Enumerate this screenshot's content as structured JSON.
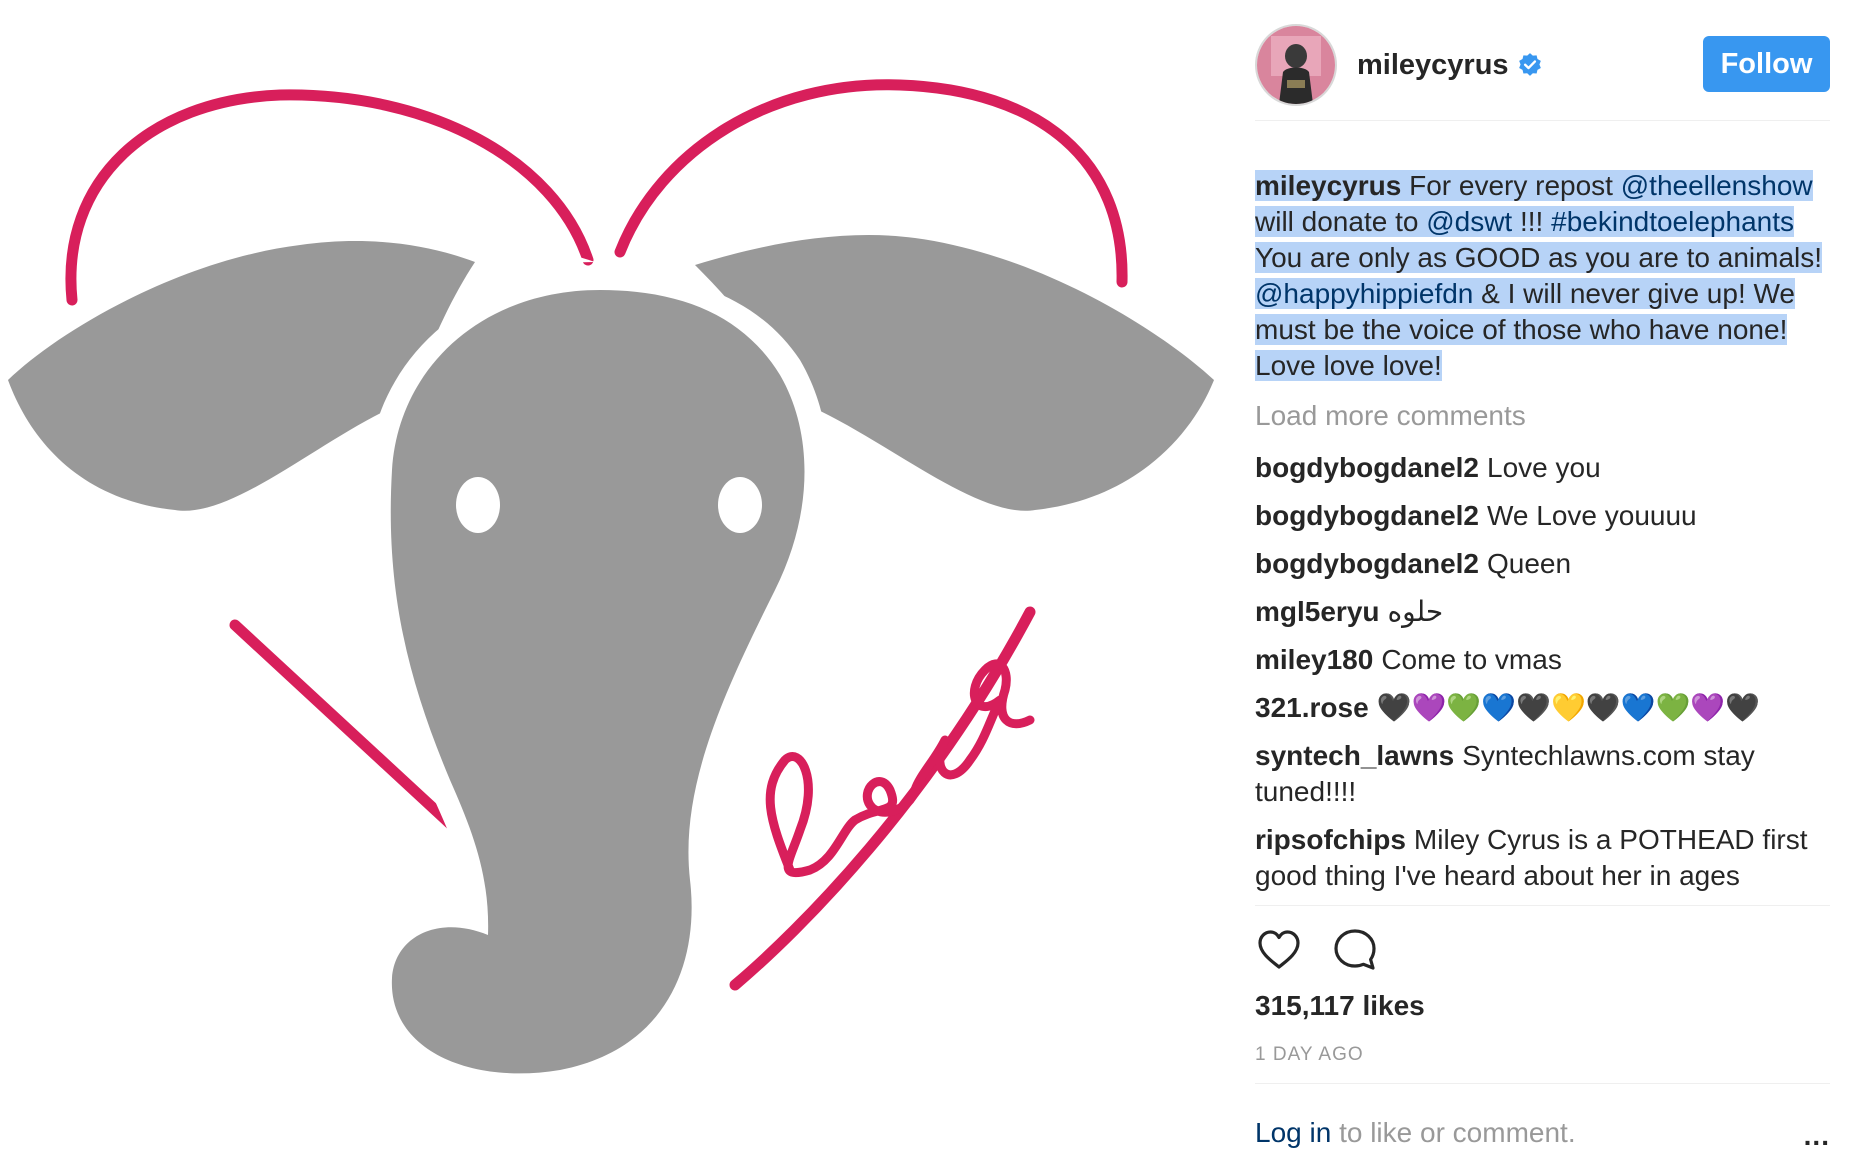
{
  "post": {
    "image_text": "love",
    "colors": {
      "elephant": "#999999",
      "heart": "#d81f5b"
    }
  },
  "header": {
    "username": "mileycyrus",
    "follow_label": "Follow",
    "verified_icon": "verified-badge-icon"
  },
  "caption": {
    "user": "mileycyrus",
    "t1": " For every repost ",
    "m1": "@theellenshow",
    "t2": " will donate to ",
    "m2": "@dswt",
    "t3": " !!! ",
    "m3": "#bekindtoelephants",
    "t4": " You are only as GOOD as you are to animals! ",
    "m4": "@happyhippiefdn",
    "t5": " & I will never give up! We must be the voice of those who have none! Love love love!"
  },
  "load_more": "Load more comments",
  "comments": [
    {
      "user": "bogdybogdanel2",
      "text": "Love you"
    },
    {
      "user": "bogdybogdanel2",
      "text": "We Love youuuu"
    },
    {
      "user": "bogdybogdanel2",
      "text": "Queen"
    },
    {
      "user": "mgl5eryu",
      "text": "حلوه"
    },
    {
      "user": "miley180",
      "text": "Come to vmas"
    },
    {
      "user": "321.rose",
      "text": "🖤💜💚💙🖤💛🖤💙💚💜🖤"
    },
    {
      "user": "syntech_lawns",
      "text": "Syntechlawns.com stay tuned!!!!"
    },
    {
      "user": "ripsofchips",
      "text": "Miley Cyrus is a POTHEAD first good thing I've heard about her in ages"
    }
  ],
  "actions": {
    "like_icon": "heart-icon",
    "comment_icon": "comment-icon"
  },
  "likes": "315,117 likes",
  "time": "1 DAY AGO",
  "footer": {
    "login_link": "Log in",
    "login_rest": " to like or comment.",
    "more": "..."
  }
}
